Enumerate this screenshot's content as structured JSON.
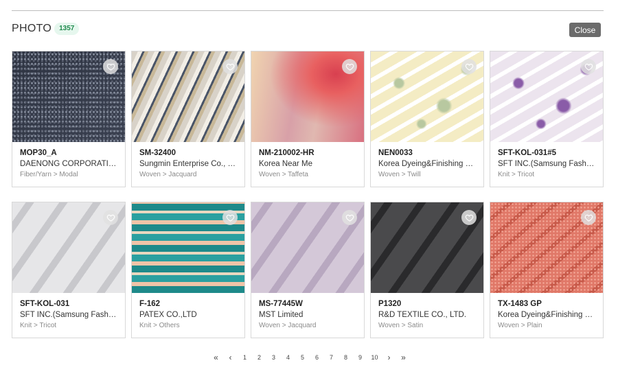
{
  "header": {
    "title": "PHOTO",
    "count": "1357",
    "close_label": "Close"
  },
  "cards": [
    {
      "code": "MOP30_A",
      "company": "DAENONG CORPORATION",
      "category": "Fiber/Yarn > Modal",
      "swatch": {
        "base": "#2e3442",
        "accent": "#5a6070",
        "pattern": "speckle"
      }
    },
    {
      "code": "SM-32400",
      "company": "Sungmin Enterprise Co., …",
      "category": "Woven > Jacquard",
      "swatch": {
        "base": "#d8d2c8",
        "accent": "#4a5568",
        "pattern": "swirl"
      }
    },
    {
      "code": "NM-210002-HR",
      "company": "Korea Near Me",
      "category": "Woven > Taffeta",
      "swatch": {
        "base": "#e8c8a0",
        "accent": "#d84050",
        "pattern": "blur"
      }
    },
    {
      "code": "NEN0033",
      "company": "Korea Dyeing&Finishing …",
      "category": "Woven > Twill",
      "swatch": {
        "base": "#f4ecc4",
        "accent": "#b8c8a0",
        "pattern": "floral"
      }
    },
    {
      "code": "SFT-KOL-031#5",
      "company": "SFT INC.(Samsung Fashi…",
      "category": "Knit > Tricot",
      "swatch": {
        "base": "#ece4ee",
        "accent": "#8a5ca8",
        "pattern": "floral"
      }
    },
    {
      "code": "SFT-KOL-031",
      "company": "SFT INC.(Samsung Fashi…",
      "category": "Knit > Tricot",
      "swatch": {
        "base": "#e6e6e8",
        "accent": "#c8c8cc",
        "pattern": "drape"
      }
    },
    {
      "code": "F-162",
      "company": "PATEX CO.,LTD",
      "category": "Knit > Others",
      "swatch": {
        "base": "#1e8a8a",
        "accent": "#f0c4a8",
        "pattern": "zigzag"
      }
    },
    {
      "code": "MS-77445W",
      "company": "MST Limited",
      "category": "Woven > Jacquard",
      "swatch": {
        "base": "#d4c8d8",
        "accent": "#b8a8c0",
        "pattern": "drape"
      }
    },
    {
      "code": "P1320",
      "company": "R&D TEXTILE CO., LTD.",
      "category": "Woven > Satin",
      "swatch": {
        "base": "#4a4a4c",
        "accent": "#2a2a2c",
        "pattern": "drape"
      }
    },
    {
      "code": "TX-1483 GP",
      "company": "Korea Dyeing&Finishing …",
      "category": "Woven > Plain",
      "swatch": {
        "base": "#e07868",
        "accent": "#f4a898",
        "pattern": "dots"
      }
    }
  ],
  "pagination": {
    "first": "«",
    "prev": "‹",
    "next": "›",
    "last": "»",
    "pages": [
      "1",
      "2",
      "3",
      "4",
      "5",
      "6",
      "7",
      "8",
      "9",
      "10"
    ]
  },
  "icons": {
    "favorite": "heart-outline-icon"
  }
}
